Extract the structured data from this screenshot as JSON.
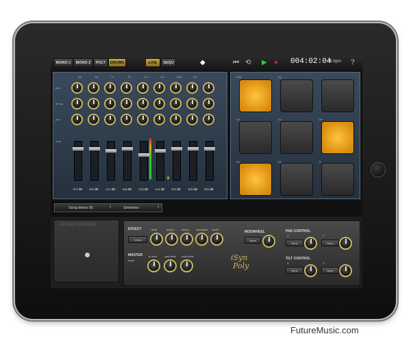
{
  "topbar": {
    "mode_buttons": [
      "MONO 1",
      "MONO 2",
      "POLY",
      "DRUMS"
    ],
    "active_mode": "DRUMS",
    "view_buttons": [
      "LIVE",
      "SEQU"
    ],
    "active_view": "LIVE",
    "time": "004:02:04",
    "bpm": "46 bpm",
    "help": "?"
  },
  "mixer": {
    "channels": [
      "BD",
      "SN",
      "TL",
      "TH",
      "CH",
      "OH",
      "RIM",
      "SQ"
    ],
    "row_labels": [
      "pitch",
      "decay",
      "pan",
      "level"
    ],
    "db_values": [
      "-4.7 dB",
      "0.0 dB",
      "-4.1 dB",
      "-4.6 dB",
      "-3.3 dB",
      "-4.4 dB",
      "0.0 dB",
      "-5.0 dB",
      "0.0 dB"
    ],
    "fader_levels": [
      0.85,
      0.85,
      0.8,
      0.85,
      0.7,
      0.8,
      0.85,
      0.85,
      0.85
    ]
  },
  "pads": {
    "labels": [
      "RIM",
      "SQ",
      "TH",
      "CH",
      "OH",
      "BD",
      "SN",
      "TL"
    ],
    "active": [
      true,
      false,
      false,
      false,
      false,
      true,
      true,
      false,
      false
    ]
  },
  "song": {
    "name": "Song demo 05",
    "kit": "Simmons"
  },
  "xy": {
    "title": "X/Y PAD CONTROL"
  },
  "effect": {
    "title": "EFFECT",
    "type": "Cross",
    "params": [
      "level",
      "delay l",
      "delay r",
      "feedback",
      "cutoff"
    ]
  },
  "master": {
    "title": "MASTER",
    "params": [
      "fx level",
      "part level",
      "main level"
    ],
    "mode": "mute"
  },
  "modwheel": {
    "title": "MODWHEEL",
    "value": "None"
  },
  "pad_control": {
    "title": "PAD CONTROL",
    "x_label": "X",
    "y_label": "Y",
    "x_value": "None",
    "y_value": "None"
  },
  "tilt_control": {
    "title": "TILT CONTROL",
    "x_label": "X",
    "y_label": "Y",
    "x_value": "None",
    "y_value": "None"
  },
  "logo": {
    "line1": "iSyn",
    "line2": "Poly"
  },
  "credit": "FutureMusic.com"
}
